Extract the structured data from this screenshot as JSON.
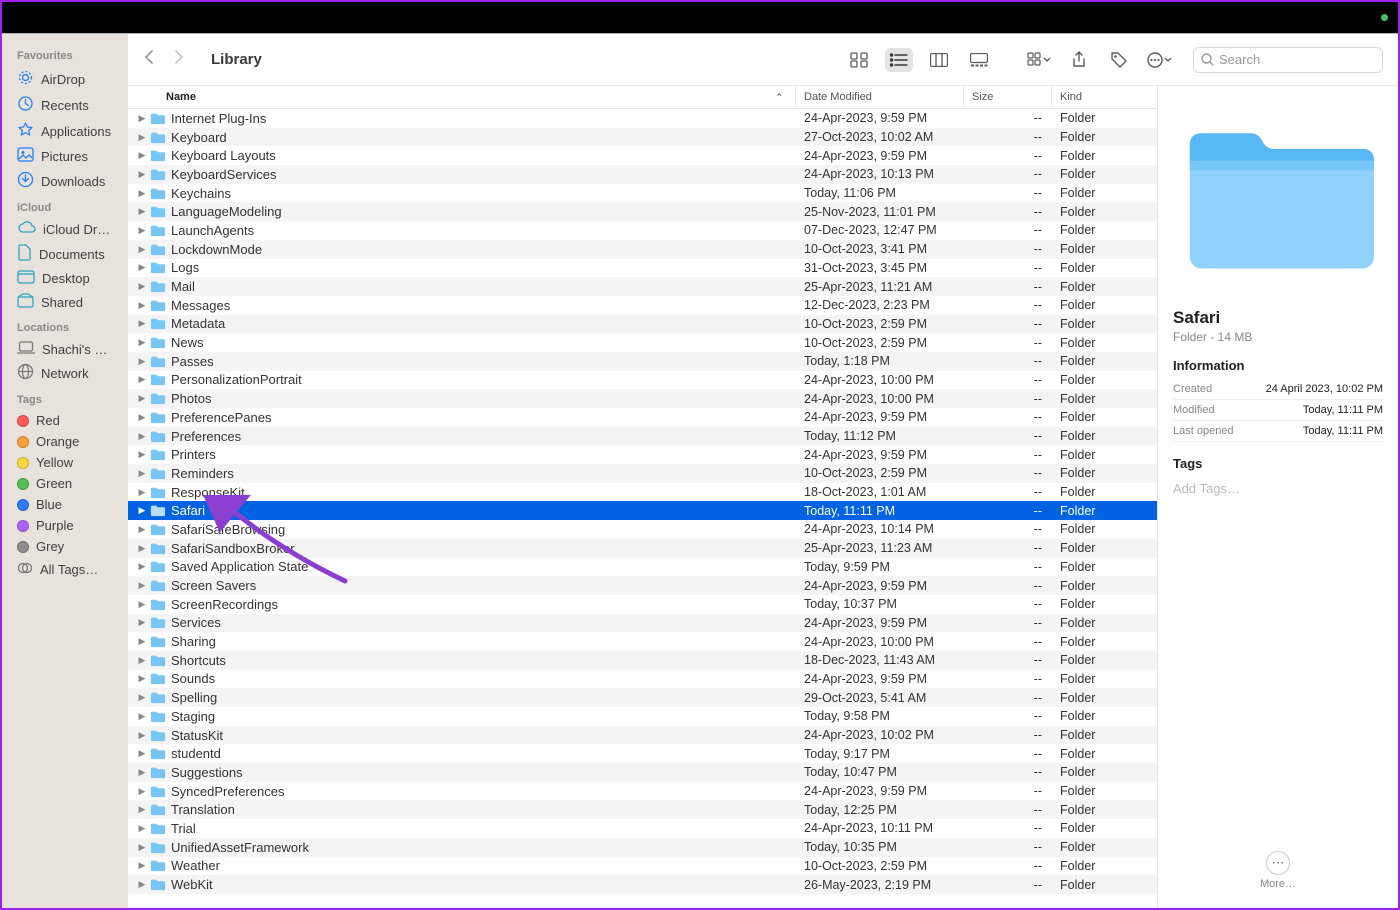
{
  "window": {
    "title": "Library"
  },
  "sidebar": {
    "sections": [
      {
        "header": "Favourites",
        "items": [
          {
            "icon": "airdrop",
            "label": "AirDrop"
          },
          {
            "icon": "recents",
            "label": "Recents"
          },
          {
            "icon": "apps",
            "label": "Applications"
          },
          {
            "icon": "pictures",
            "label": "Pictures"
          },
          {
            "icon": "downloads",
            "label": "Downloads"
          }
        ]
      },
      {
        "header": "iCloud",
        "items": [
          {
            "icon": "cloud",
            "label": "iCloud Drive"
          },
          {
            "icon": "doc",
            "label": "Documents"
          },
          {
            "icon": "desktop",
            "label": "Desktop"
          },
          {
            "icon": "shared",
            "label": "Shared"
          }
        ]
      },
      {
        "header": "Locations",
        "items": [
          {
            "icon": "laptop",
            "label": "Shachi's M…"
          },
          {
            "icon": "network",
            "label": "Network"
          }
        ]
      },
      {
        "header": "Tags",
        "items": [
          {
            "icon": "tag",
            "color": "#ff5b56",
            "label": "Red"
          },
          {
            "icon": "tag",
            "color": "#ff9e3d",
            "label": "Orange"
          },
          {
            "icon": "tag",
            "color": "#ffd93d",
            "label": "Yellow"
          },
          {
            "icon": "tag",
            "color": "#51c151",
            "label": "Green"
          },
          {
            "icon": "tag",
            "color": "#2e7bff",
            "label": "Blue"
          },
          {
            "icon": "tag",
            "color": "#b062ff",
            "label": "Purple"
          },
          {
            "icon": "tag",
            "color": "#8e8e8e",
            "label": "Grey"
          },
          {
            "icon": "alltags",
            "label": "All Tags…"
          }
        ]
      }
    ]
  },
  "columns": {
    "name": "Name",
    "date": "Date Modified",
    "size": "Size",
    "kind": "Kind"
  },
  "search_placeholder": "Search",
  "rows": [
    {
      "name": "Internet Plug-Ins",
      "date": "24-Apr-2023, 9:59 PM",
      "size": "--",
      "kind": "Folder"
    },
    {
      "name": "Keyboard",
      "date": "27-Oct-2023, 10:02 AM",
      "size": "--",
      "kind": "Folder"
    },
    {
      "name": "Keyboard Layouts",
      "date": "24-Apr-2023, 9:59 PM",
      "size": "--",
      "kind": "Folder"
    },
    {
      "name": "KeyboardServices",
      "date": "24-Apr-2023, 10:13 PM",
      "size": "--",
      "kind": "Folder"
    },
    {
      "name": "Keychains",
      "date": "Today, 11:06 PM",
      "size": "--",
      "kind": "Folder"
    },
    {
      "name": "LanguageModeling",
      "date": "25-Nov-2023, 11:01 PM",
      "size": "--",
      "kind": "Folder"
    },
    {
      "name": "LaunchAgents",
      "date": "07-Dec-2023, 12:47 PM",
      "size": "--",
      "kind": "Folder"
    },
    {
      "name": "LockdownMode",
      "date": "10-Oct-2023, 3:41 PM",
      "size": "--",
      "kind": "Folder"
    },
    {
      "name": "Logs",
      "date": "31-Oct-2023, 3:45 PM",
      "size": "--",
      "kind": "Folder"
    },
    {
      "name": "Mail",
      "date": "25-Apr-2023, 11:21 AM",
      "size": "--",
      "kind": "Folder"
    },
    {
      "name": "Messages",
      "date": "12-Dec-2023, 2:23 PM",
      "size": "--",
      "kind": "Folder"
    },
    {
      "name": "Metadata",
      "date": "10-Oct-2023, 2:59 PM",
      "size": "--",
      "kind": "Folder"
    },
    {
      "name": "News",
      "date": "10-Oct-2023, 2:59 PM",
      "size": "--",
      "kind": "Folder"
    },
    {
      "name": "Passes",
      "date": "Today, 1:18 PM",
      "size": "--",
      "kind": "Folder"
    },
    {
      "name": "PersonalizationPortrait",
      "date": "24-Apr-2023, 10:00 PM",
      "size": "--",
      "kind": "Folder"
    },
    {
      "name": "Photos",
      "date": "24-Apr-2023, 10:00 PM",
      "size": "--",
      "kind": "Folder"
    },
    {
      "name": "PreferencePanes",
      "date": "24-Apr-2023, 9:59 PM",
      "size": "--",
      "kind": "Folder"
    },
    {
      "name": "Preferences",
      "date": "Today, 11:12 PM",
      "size": "--",
      "kind": "Folder"
    },
    {
      "name": "Printers",
      "date": "24-Apr-2023, 9:59 PM",
      "size": "--",
      "kind": "Folder"
    },
    {
      "name": "Reminders",
      "date": "10-Oct-2023, 2:59 PM",
      "size": "--",
      "kind": "Folder"
    },
    {
      "name": "ResponseKit",
      "date": "18-Oct-2023, 1:01 AM",
      "size": "--",
      "kind": "Folder"
    },
    {
      "name": "Safari",
      "date": "Today, 11:11 PM",
      "size": "--",
      "kind": "Folder",
      "selected": true
    },
    {
      "name": "SafariSafeBrowsing",
      "date": "24-Apr-2023, 10:14 PM",
      "size": "--",
      "kind": "Folder"
    },
    {
      "name": "SafariSandboxBroker",
      "date": "25-Apr-2023, 11:23 AM",
      "size": "--",
      "kind": "Folder"
    },
    {
      "name": "Saved Application State",
      "date": "Today, 9:59 PM",
      "size": "--",
      "kind": "Folder"
    },
    {
      "name": "Screen Savers",
      "date": "24-Apr-2023, 9:59 PM",
      "size": "--",
      "kind": "Folder"
    },
    {
      "name": "ScreenRecordings",
      "date": "Today, 10:37 PM",
      "size": "--",
      "kind": "Folder"
    },
    {
      "name": "Services",
      "date": "24-Apr-2023, 9:59 PM",
      "size": "--",
      "kind": "Folder"
    },
    {
      "name": "Sharing",
      "date": "24-Apr-2023, 10:00 PM",
      "size": "--",
      "kind": "Folder"
    },
    {
      "name": "Shortcuts",
      "date": "18-Dec-2023, 11:43 AM",
      "size": "--",
      "kind": "Folder"
    },
    {
      "name": "Sounds",
      "date": "24-Apr-2023, 9:59 PM",
      "size": "--",
      "kind": "Folder"
    },
    {
      "name": "Spelling",
      "date": "29-Oct-2023, 5:41 AM",
      "size": "--",
      "kind": "Folder"
    },
    {
      "name": "Staging",
      "date": "Today, 9:58 PM",
      "size": "--",
      "kind": "Folder"
    },
    {
      "name": "StatusKit",
      "date": "24-Apr-2023, 10:02 PM",
      "size": "--",
      "kind": "Folder"
    },
    {
      "name": "studentd",
      "date": "Today, 9:17 PM",
      "size": "--",
      "kind": "Folder"
    },
    {
      "name": "Suggestions",
      "date": "Today, 10:47 PM",
      "size": "--",
      "kind": "Folder"
    },
    {
      "name": "SyncedPreferences",
      "date": "24-Apr-2023, 9:59 PM",
      "size": "--",
      "kind": "Folder"
    },
    {
      "name": "Translation",
      "date": "Today, 12:25 PM",
      "size": "--",
      "kind": "Folder"
    },
    {
      "name": "Trial",
      "date": "24-Apr-2023, 10:11 PM",
      "size": "--",
      "kind": "Folder"
    },
    {
      "name": "UnifiedAssetFramework",
      "date": "Today, 10:35 PM",
      "size": "--",
      "kind": "Folder"
    },
    {
      "name": "Weather",
      "date": "10-Oct-2023, 2:59 PM",
      "size": "--",
      "kind": "Folder"
    },
    {
      "name": "WebKit",
      "date": "26-May-2023, 2:19 PM",
      "size": "--",
      "kind": "Folder"
    }
  ],
  "preview": {
    "name": "Safari",
    "subtitle": "Folder - 14 MB",
    "info_header": "Information",
    "info": [
      {
        "k": "Created",
        "v": "24 April 2023, 10:02 PM"
      },
      {
        "k": "Modified",
        "v": "Today, 11:11 PM"
      },
      {
        "k": "Last opened",
        "v": "Today, 11:11 PM"
      }
    ],
    "tags_header": "Tags",
    "tags_placeholder": "Add Tags…",
    "more": "More…"
  }
}
